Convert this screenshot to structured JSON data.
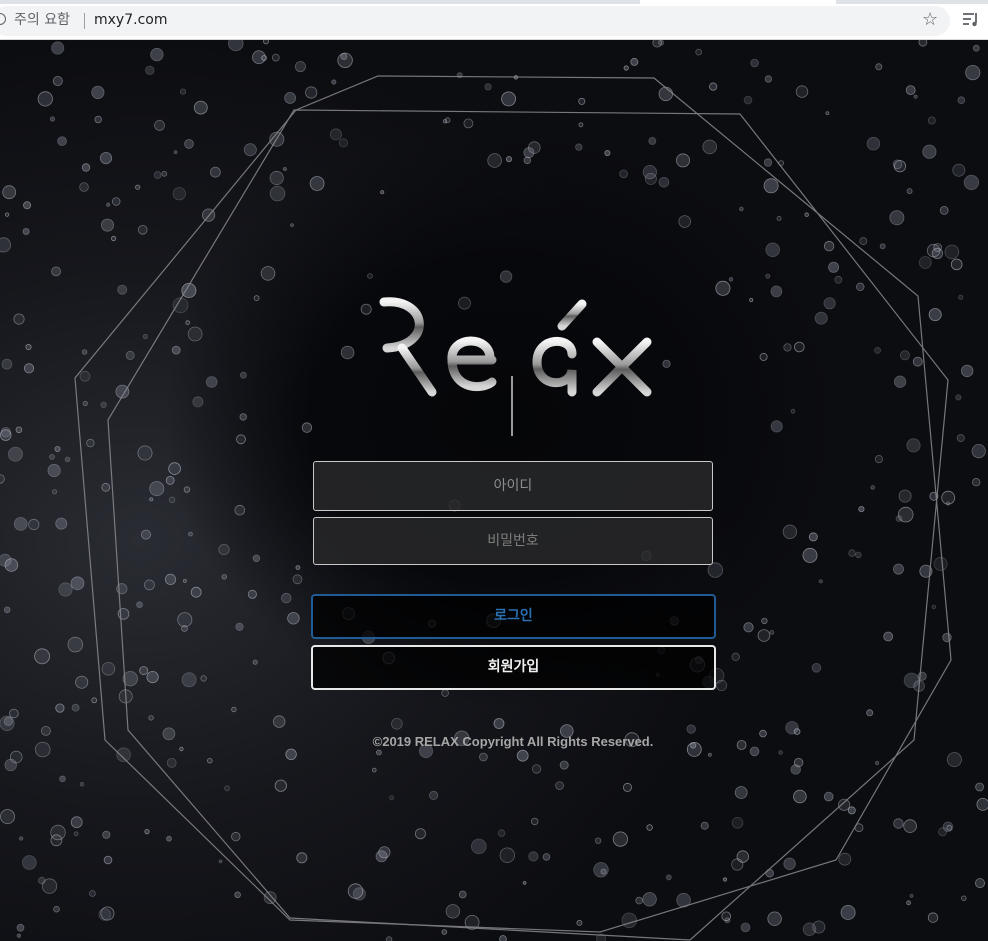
{
  "browser": {
    "security_label": "주의 요함",
    "url": "mxy7.com"
  },
  "brand": {
    "logo_text": "Relax"
  },
  "login_form": {
    "id_placeholder": "아이디",
    "password_placeholder": "비밀번호",
    "login_label": "로그인",
    "signup_label": "회원가입"
  },
  "footer": {
    "copyright": "©2019 RELAX Copyright All Rights Reserved."
  },
  "colors": {
    "login_accent": "#2a6fb0",
    "background": "#0b0c10"
  }
}
